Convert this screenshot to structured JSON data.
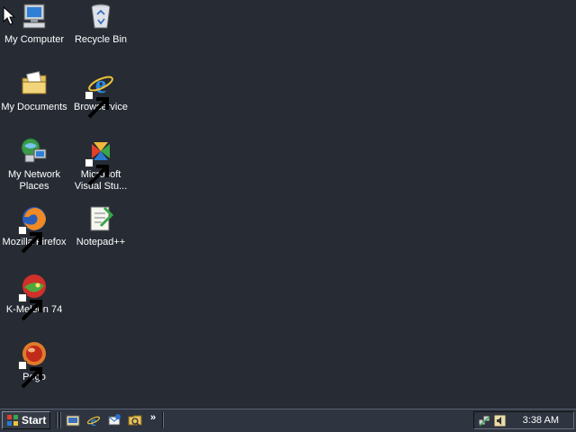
{
  "desktop": {
    "icons": [
      {
        "label": "My Computer",
        "icon": "my-computer-icon"
      },
      {
        "label": "Recycle Bin",
        "icon": "recycle-bin-icon"
      },
      {
        "label": "My Documents",
        "icon": "my-documents-icon"
      },
      {
        "label": "Browservice",
        "icon": "internet-explorer-icon"
      },
      {
        "label": "My Network Places",
        "icon": "network-places-icon"
      },
      {
        "label": "Microsoft Visual Stu...",
        "icon": "visual-studio-icon"
      },
      {
        "label": "Mozilla Firefox",
        "icon": "firefox-icon"
      },
      {
        "label": "Notepad++",
        "icon": "notepad-plus-plus-icon"
      },
      {
        "label": "K-Meleon 74",
        "icon": "k-meleon-icon"
      },
      {
        "label": "Pego",
        "icon": "pego-icon"
      }
    ]
  },
  "taskbar": {
    "start_label": "Start",
    "quick_launch": [
      {
        "icon": "show-desktop-icon"
      },
      {
        "icon": "internet-explorer-icon"
      },
      {
        "icon": "outlook-express-icon"
      },
      {
        "icon": "windows-explorer-icon"
      }
    ],
    "more_label": "»",
    "tray": {
      "icons": [
        "network-tray-icon",
        "volume-tray-icon"
      ],
      "clock": "3:38 AM"
    }
  },
  "colors": {
    "desktop_background": "#262b34",
    "taskbar_background": "#2e3440",
    "text": "#ffffff"
  }
}
